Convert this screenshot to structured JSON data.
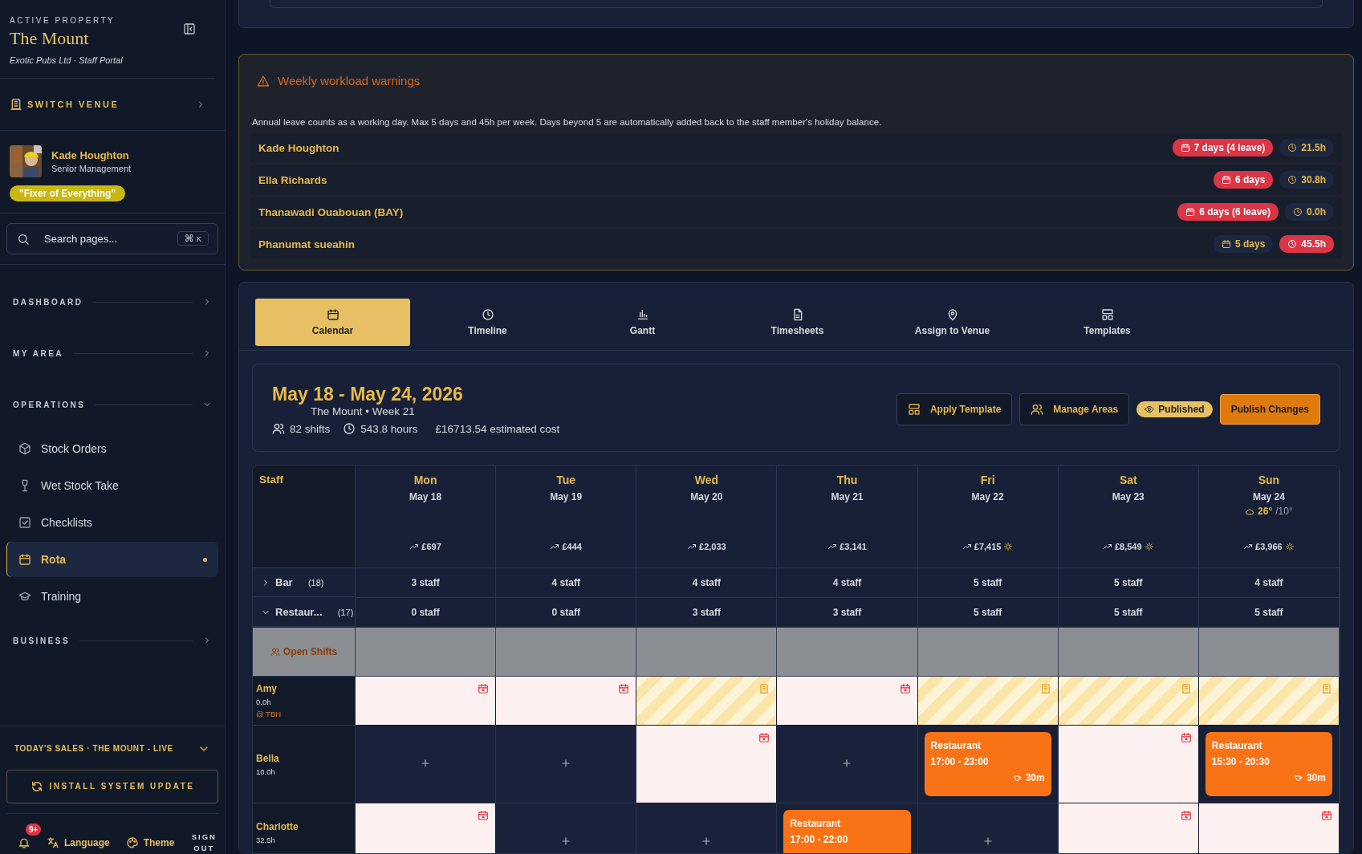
{
  "sidebar": {
    "eyebrow": "ACTIVE PROPERTY",
    "venue": "The Mount",
    "org": "Exotic Pubs Ltd · Staff Portal",
    "switch_label": "SWITCH VENUE",
    "user": {
      "name": "Kade Houghton",
      "role": "Senior Management",
      "tag": "\"Fixer of Everything\""
    },
    "search": {
      "placeholder": "Search pages...",
      "shortcut_symbol": "⌘",
      "shortcut_key": "K"
    },
    "sections": [
      {
        "label": "DASHBOARD",
        "expanded": false
      },
      {
        "label": "MY AREA",
        "expanded": false
      },
      {
        "label": "OPERATIONS",
        "expanded": true,
        "items": [
          {
            "label": "Stock Orders",
            "selected": false
          },
          {
            "label": "Wet Stock Take",
            "selected": false
          },
          {
            "label": "Checklists",
            "selected": false
          },
          {
            "label": "Rota",
            "selected": true
          },
          {
            "label": "Training",
            "selected": false
          }
        ]
      },
      {
        "label": "BUSINESS",
        "expanded": false
      }
    ],
    "sales_label": "TODAY'S SALES · THE MOUNT - LIVE",
    "update_button": "INSTALL SYSTEM UPDATE",
    "notifications": "9+",
    "language": "Language",
    "theme": "Theme",
    "sign_out": "SIGN OUT"
  },
  "warnings": {
    "title": "Weekly workload warnings",
    "note": "Annual leave counts as a working day. Max 5 days and 45h per week. Days beyond 5 are automatically added back to the staff member's holiday balance.",
    "rows": [
      {
        "name": "Kade Houghton",
        "days": {
          "text": "7 days (4 leave)",
          "alert": true
        },
        "hours": {
          "text": "21.5h",
          "alert": false
        }
      },
      {
        "name": "Ella Richards",
        "days": {
          "text": "6 days",
          "alert": true
        },
        "hours": {
          "text": "30.8h",
          "alert": false
        }
      },
      {
        "name": "Thanawadi Ouabouan (BAY)",
        "days": {
          "text": "6 days (6 leave)",
          "alert": true
        },
        "hours": {
          "text": "0.0h",
          "alert": false
        }
      },
      {
        "name": "Phanumat sueahin",
        "days": {
          "text": "5 days",
          "alert": false
        },
        "hours": {
          "text": "45.5h",
          "alert": true
        }
      }
    ]
  },
  "tabs": [
    {
      "label": "Calendar",
      "selected": true
    },
    {
      "label": "Timeline",
      "selected": false
    },
    {
      "label": "Gantt",
      "selected": false
    },
    {
      "label": "Timesheets",
      "selected": false
    },
    {
      "label": "Assign to Venue",
      "selected": false
    },
    {
      "label": "Templates",
      "selected": false
    }
  ],
  "week": {
    "title": "May 18 - May 24, 2026",
    "subtitle": "The Mount • Week 21",
    "shifts": "82 shifts",
    "hours": "543.8 hours",
    "cost": "£16713.54 estimated cost",
    "buttons": [
      "Apply Template",
      "Manage Areas"
    ],
    "status": "Published",
    "publish": "Publish Changes"
  },
  "table": {
    "staff_heading": "Staff",
    "open_shifts": "Open Shifts",
    "days": [
      {
        "name": "Mon",
        "date": "May 18",
        "sales": "£697",
        "busy": false
      },
      {
        "name": "Tue",
        "date": "May 19",
        "sales": "£444",
        "busy": false
      },
      {
        "name": "Wed",
        "date": "May 20",
        "sales": "£2,033",
        "busy": false
      },
      {
        "name": "Thu",
        "date": "May 21",
        "sales": "£3,141",
        "busy": false
      },
      {
        "name": "Fri",
        "date": "May 22",
        "sales": "£7,415",
        "busy": true
      },
      {
        "name": "Sat",
        "date": "May 23",
        "sales": "£8,549",
        "busy": true
      },
      {
        "name": "Sun",
        "date": "May 24",
        "sales": "£3,966",
        "busy": true,
        "weather": {
          "high": "26°",
          "low": "/10°"
        }
      }
    ],
    "areas": [
      {
        "name": "Bar",
        "count": "(18)",
        "expanded": false,
        "staff": [
          "3 staff",
          "4 staff",
          "4 staff",
          "4 staff",
          "5 staff",
          "5 staff",
          "4 staff"
        ]
      },
      {
        "name": "Restaur...",
        "count": "(17)",
        "expanded": true,
        "staff": [
          "0 staff",
          "0 staff",
          "3 staff",
          "3 staff",
          "5 staff",
          "5 staff",
          "5 staff"
        ]
      }
    ],
    "people": [
      {
        "name": "Amy",
        "hours": "0.0h",
        "note": "@ TBH",
        "cells": [
          {
            "kind": "unavailable"
          },
          {
            "kind": "unavailable"
          },
          {
            "kind": "leave"
          },
          {
            "kind": "unavailable"
          },
          {
            "kind": "leave"
          },
          {
            "kind": "leave"
          },
          {
            "kind": "leave"
          }
        ]
      },
      {
        "name": "Bella",
        "hours": "10.0h",
        "cells": [
          {
            "kind": "empty"
          },
          {
            "kind": "empty"
          },
          {
            "kind": "unavailable"
          },
          {
            "kind": "empty"
          },
          {
            "kind": "shift",
            "area": "Restaurant",
            "time": "17:00 - 23:00",
            "break": "30m"
          },
          {
            "kind": "unavailable"
          },
          {
            "kind": "shift",
            "area": "Restaurant",
            "time": "15:30 - 20:30",
            "break": "30m"
          }
        ]
      },
      {
        "name": "Charlotte",
        "hours": "32.5h",
        "cells": [
          {
            "kind": "unavailable"
          },
          {
            "kind": "empty"
          },
          {
            "kind": "empty"
          },
          {
            "kind": "shift",
            "area": "Restaurant",
            "time": "17:00 - 22:00"
          },
          {
            "kind": "empty"
          },
          {
            "kind": "unavailable"
          },
          {
            "kind": "unavailable"
          }
        ]
      }
    ]
  }
}
